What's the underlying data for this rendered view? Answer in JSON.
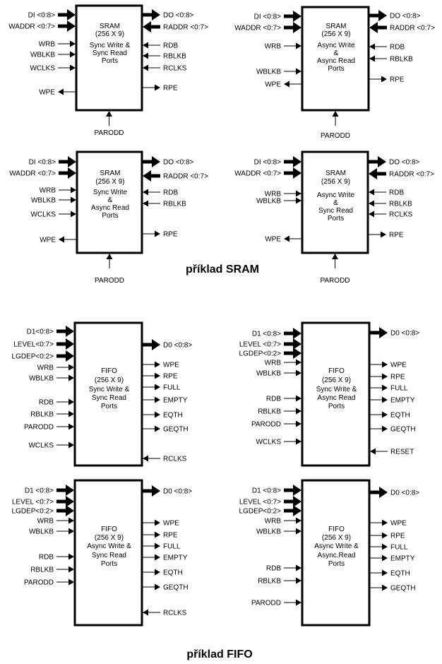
{
  "captions": {
    "sram": "příklad SRAM",
    "fifo": "příklad FIFO"
  },
  "colors": {
    "ink": "#000000",
    "background": "#ffffff"
  },
  "blocks": [
    {
      "id": "sram-sync-sync",
      "type": "SRAM",
      "text": [
        "SRAM",
        "(256 X 9)",
        "Sync Write &",
        "Sync Read",
        "Ports"
      ],
      "left_pins": [
        {
          "label": "DI <0:8>",
          "dir": "in",
          "bus": true
        },
        {
          "label": "WADDR <0:7>",
          "dir": "in",
          "bus": true
        },
        {
          "label": "WRB",
          "dir": "in"
        },
        {
          "label": "WBLKB",
          "dir": "in"
        },
        {
          "label": "WCLKS",
          "dir": "in"
        },
        {
          "label": "WPE",
          "dir": "out"
        }
      ],
      "right_pins": [
        {
          "label": "DO <0:8>",
          "dir": "out",
          "bus": true
        },
        {
          "label": "RADDR <0:7>",
          "dir": "in",
          "bus": true
        },
        {
          "label": "RDB",
          "dir": "in"
        },
        {
          "label": "RBLKB",
          "dir": "in"
        },
        {
          "label": "RCLKS",
          "dir": "in"
        },
        {
          "label": "RPE",
          "dir": "out"
        }
      ],
      "bottom_pin": {
        "label": "PARODD",
        "dir": "in"
      }
    },
    {
      "id": "sram-async-async",
      "type": "SRAM",
      "text": [
        "SRAM",
        "(256 X 9)",
        "Async Write",
        "&",
        "Async Read",
        "Ports"
      ],
      "left_pins": [
        {
          "label": "DI <0:8>",
          "dir": "in",
          "bus": true
        },
        {
          "label": "WADDR <0:7>",
          "dir": "in",
          "bus": true
        },
        {
          "label": "WRB",
          "dir": "in"
        },
        {
          "label": "WBLKB",
          "dir": "in"
        },
        {
          "label": "WPE",
          "dir": "out"
        }
      ],
      "right_pins": [
        {
          "label": "DO <0:8>",
          "dir": "out",
          "bus": true
        },
        {
          "label": "RADDR <0:7>",
          "dir": "in",
          "bus": true
        },
        {
          "label": "RDB",
          "dir": "in"
        },
        {
          "label": "RBLKB",
          "dir": "in"
        },
        {
          "label": "RPE",
          "dir": "out"
        }
      ],
      "bottom_pin": {
        "label": "PARODD",
        "dir": "in"
      }
    },
    {
      "id": "sram-sync-async",
      "type": "SRAM",
      "text": [
        "SRAM",
        "(256 X 9)",
        "Sync Write",
        "&",
        "Async Read",
        "Ports"
      ],
      "left_pins": [
        {
          "label": "DI <0:8>",
          "dir": "in",
          "bus": true
        },
        {
          "label": "WADDR <0:7>",
          "dir": "in",
          "bus": true
        },
        {
          "label": "WRB",
          "dir": "in"
        },
        {
          "label": "WBLKB",
          "dir": "in"
        },
        {
          "label": "WCLKS",
          "dir": "in"
        },
        {
          "label": "WPE",
          "dir": "out"
        }
      ],
      "right_pins": [
        {
          "label": "DO <0:8>",
          "dir": "out",
          "bus": true
        },
        {
          "label": "RADDR <0:7>",
          "dir": "in",
          "bus": true
        },
        {
          "label": "RDB",
          "dir": "in"
        },
        {
          "label": "RBLKB",
          "dir": "in"
        },
        {
          "label": "RPE",
          "dir": "out"
        }
      ],
      "bottom_pin": {
        "label": "PARODD",
        "dir": "in"
      }
    },
    {
      "id": "sram-async-sync",
      "type": "SRAM",
      "text": [
        "SRAM",
        "(256 X 9)",
        "Async Write",
        "&",
        "Sync Read",
        "Ports"
      ],
      "left_pins": [
        {
          "label": "DI <0:8>",
          "dir": "in",
          "bus": true
        },
        {
          "label": "WADDR <0:7>",
          "dir": "in",
          "bus": true
        },
        {
          "label": "WRB",
          "dir": "in"
        },
        {
          "label": "WBLKB",
          "dir": "in"
        },
        {
          "label": "WPE",
          "dir": "out"
        }
      ],
      "right_pins": [
        {
          "label": "DO <0:8>",
          "dir": "out",
          "bus": true
        },
        {
          "label": "RADDR <0:7>",
          "dir": "in",
          "bus": true
        },
        {
          "label": "RDB",
          "dir": "in"
        },
        {
          "label": "RBLKB",
          "dir": "in"
        },
        {
          "label": "RCLKS",
          "dir": "in"
        },
        {
          "label": "RPE",
          "dir": "out"
        }
      ],
      "bottom_pin": {
        "label": "PARODD",
        "dir": "in"
      }
    },
    {
      "id": "fifo-sync-sync",
      "type": "FIFO",
      "text": [
        "FIFO",
        "(256 X 9)",
        "Sync Write &",
        "Sync Read",
        "Ports"
      ],
      "left_pins": [
        {
          "label": "D1<0:8>",
          "dir": "in",
          "bus": true
        },
        {
          "label": "LEVEL<0:7>",
          "dir": "in",
          "bus": true
        },
        {
          "label": "LGDEP<0:2>",
          "dir": "in",
          "bus": true
        },
        {
          "label": "WRB",
          "dir": "in"
        },
        {
          "label": "WBLKB",
          "dir": "in"
        },
        {
          "label": "RDB",
          "dir": "in"
        },
        {
          "label": "RBLKB",
          "dir": "in"
        },
        {
          "label": "PARODD",
          "dir": "in"
        },
        {
          "label": "WCLKS",
          "dir": "in"
        }
      ],
      "right_pins": [
        {
          "label": "D0 <0:8>",
          "dir": "out",
          "bus": true
        },
        {
          "label": "WPE",
          "dir": "out"
        },
        {
          "label": "RPE",
          "dir": "out"
        },
        {
          "label": "FULL",
          "dir": "out"
        },
        {
          "label": "EMPTY",
          "dir": "out"
        },
        {
          "label": "EQTH",
          "dir": "out"
        },
        {
          "label": "GEQTH",
          "dir": "out"
        },
        {
          "label": "RCLKS",
          "dir": "in"
        }
      ]
    },
    {
      "id": "fifo-sync-async",
      "type": "FIFO",
      "text": [
        "FIFO",
        "(256 X 9)",
        "Sync Write &",
        "Async Read",
        "Ports"
      ],
      "left_pins": [
        {
          "label": "D1 <0:8>",
          "dir": "in",
          "bus": true
        },
        {
          "label": "LEVEL <0:7>",
          "dir": "in",
          "bus": true
        },
        {
          "label": "LGDEP<0:2>",
          "dir": "in",
          "bus": true
        },
        {
          "label": "WRB",
          "dir": "in"
        },
        {
          "label": "WBLKB",
          "dir": "in"
        },
        {
          "label": "RDB",
          "dir": "in"
        },
        {
          "label": "RBLKB",
          "dir": "in"
        },
        {
          "label": "PARODD",
          "dir": "in"
        },
        {
          "label": "WCLKS",
          "dir": "in"
        }
      ],
      "right_pins": [
        {
          "label": "D0 <0:8>",
          "dir": "out",
          "bus": true
        },
        {
          "label": "WPE",
          "dir": "out"
        },
        {
          "label": "RPE",
          "dir": "out"
        },
        {
          "label": "FULL",
          "dir": "out"
        },
        {
          "label": "EMPTY",
          "dir": "out"
        },
        {
          "label": "EQTH",
          "dir": "out"
        },
        {
          "label": "GEQTH",
          "dir": "out"
        },
        {
          "label": "RESET",
          "dir": "in"
        }
      ]
    },
    {
      "id": "fifo-async-sync",
      "type": "FIFO",
      "text": [
        "FIFO",
        "(256 X 9)",
        "Async Write &",
        "Sync Read",
        "Ports"
      ],
      "left_pins": [
        {
          "label": "D1 <0:8>",
          "dir": "in",
          "bus": true
        },
        {
          "label": "LEVEL <0:7>",
          "dir": "in",
          "bus": true
        },
        {
          "label": "LGDEP<0:2>",
          "dir": "in",
          "bus": true
        },
        {
          "label": "WRB",
          "dir": "in"
        },
        {
          "label": "WBLKB",
          "dir": "in"
        },
        {
          "label": "RDB",
          "dir": "in"
        },
        {
          "label": "RBLKB",
          "dir": "in"
        },
        {
          "label": "PARODD",
          "dir": "in"
        }
      ],
      "right_pins": [
        {
          "label": "D0 <0:8>",
          "dir": "out",
          "bus": true
        },
        {
          "label": "WPE",
          "dir": "out"
        },
        {
          "label": "RPE",
          "dir": "out"
        },
        {
          "label": "FULL",
          "dir": "out"
        },
        {
          "label": "EMPTY",
          "dir": "out"
        },
        {
          "label": "EQTH",
          "dir": "out"
        },
        {
          "label": "GEQTH",
          "dir": "out"
        },
        {
          "label": "RCLKS",
          "dir": "in"
        }
      ]
    },
    {
      "id": "fifo-async-async",
      "type": "FIFO",
      "text": [
        "FIFO",
        "(256 X 9)",
        "Async Write &",
        "Async.Read",
        "Ports"
      ],
      "left_pins": [
        {
          "label": "D1 <0:8>",
          "dir": "in",
          "bus": true
        },
        {
          "label": "LEVEL <0:7>",
          "dir": "in",
          "bus": true
        },
        {
          "label": "LGDEP<0:2>",
          "dir": "in",
          "bus": true
        },
        {
          "label": "WRB",
          "dir": "in"
        },
        {
          "label": "WBLKB",
          "dir": "in"
        },
        {
          "label": "RDB",
          "dir": "in"
        },
        {
          "label": "RBLKB",
          "dir": "in"
        },
        {
          "label": "PARODD",
          "dir": "in"
        }
      ],
      "right_pins": [
        {
          "label": "D0 <0:8>",
          "dir": "out",
          "bus": true
        },
        {
          "label": "WPE",
          "dir": "out"
        },
        {
          "label": "RPE",
          "dir": "out"
        },
        {
          "label": "FULL",
          "dir": "out"
        },
        {
          "label": "EMPTY",
          "dir": "out"
        },
        {
          "label": "EQTH",
          "dir": "out"
        },
        {
          "label": "GEQTH",
          "dir": "out"
        }
      ]
    }
  ]
}
